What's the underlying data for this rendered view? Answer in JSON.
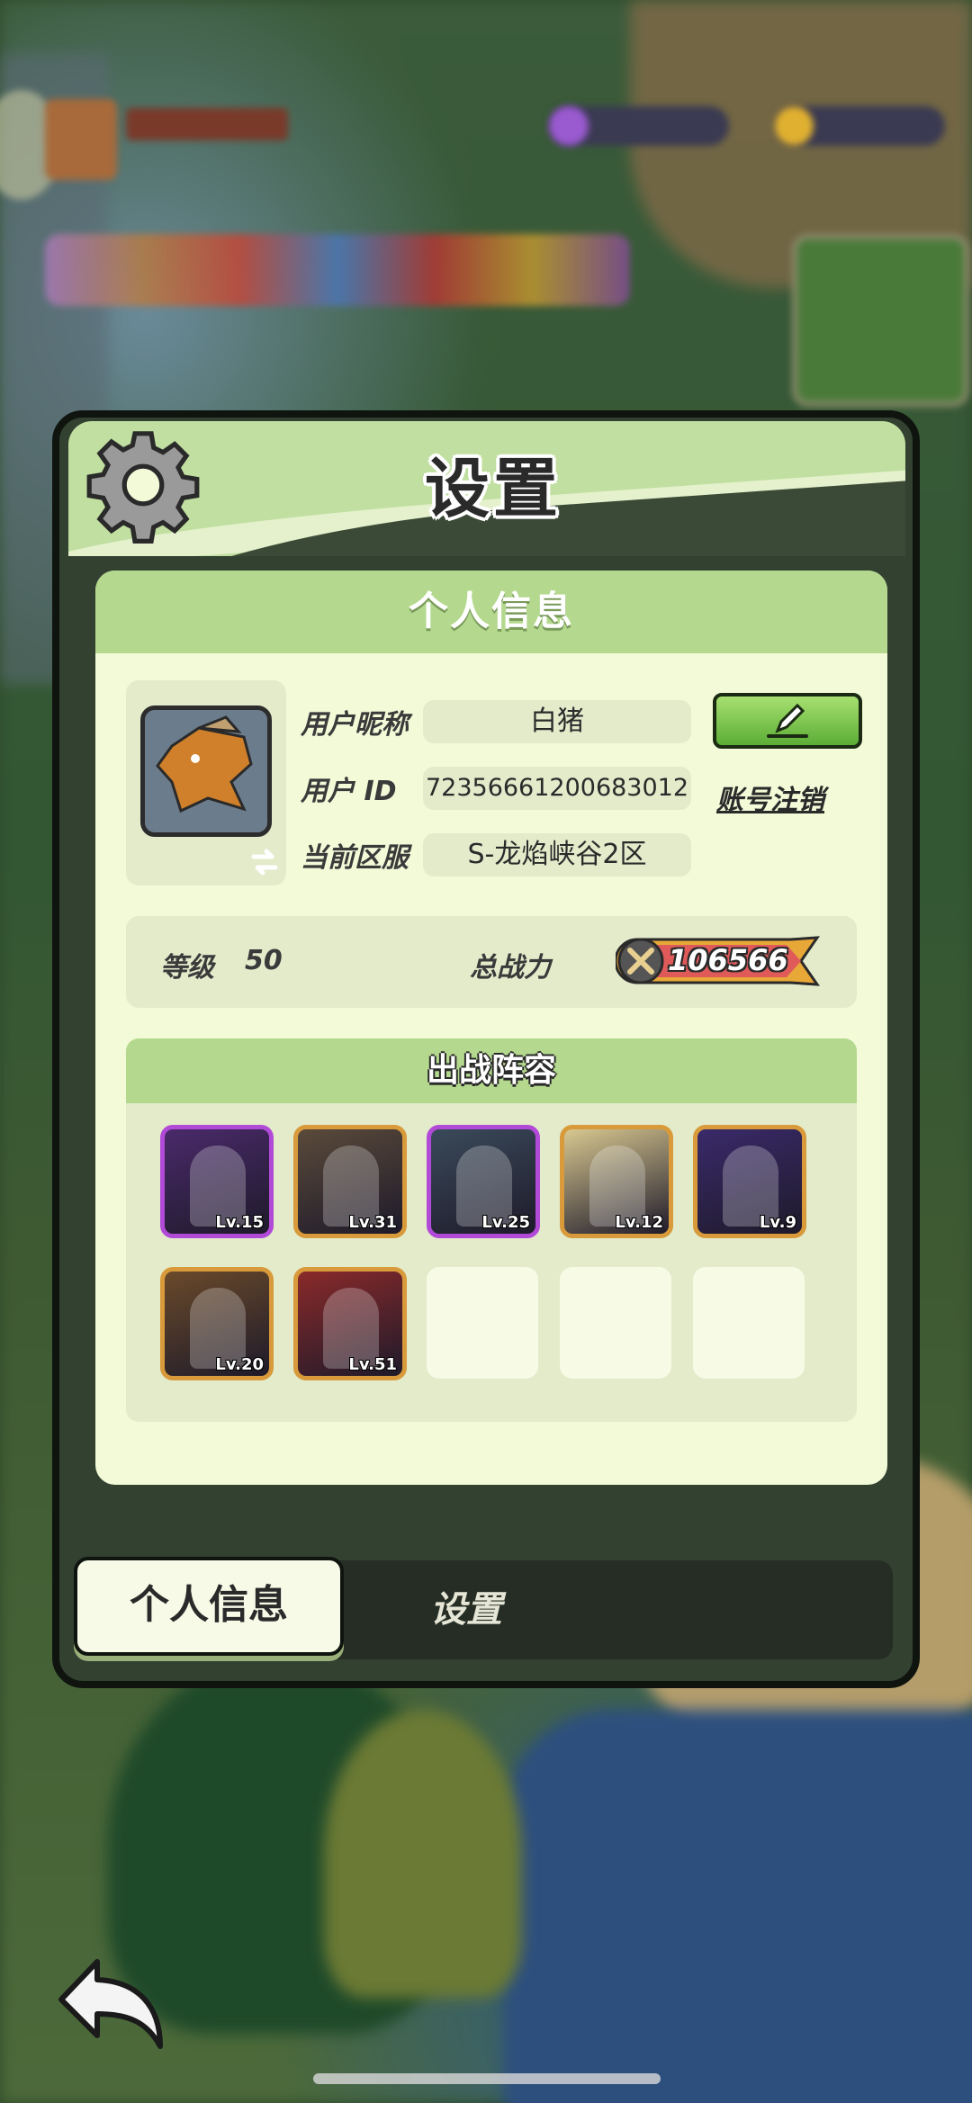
{
  "panel": {
    "title": "设置",
    "card_title": "个人信息",
    "profile": {
      "nickname_label": "用户昵称",
      "nickname": "白猪",
      "id_label": "用户  ID",
      "user_id": "72356661200683012",
      "server_label": "当前区服",
      "server": "S-龙焰峡谷2区",
      "cancel_account": "账号注销"
    },
    "stats": {
      "level_label": "等级",
      "level": "50",
      "power_label": "总战力",
      "power": "106566"
    },
    "lineup": {
      "title": "出战阵容",
      "heroes": [
        {
          "level": "Lv.15",
          "frame": "purple",
          "color": "#4a2a6a"
        },
        {
          "level": "Lv.31",
          "frame": "gold",
          "color": "#5a4a3a"
        },
        {
          "level": "Lv.25",
          "frame": "purple",
          "color": "#3a4a5a"
        },
        {
          "level": "Lv.12",
          "frame": "gold",
          "color": "#d8c890"
        },
        {
          "level": "Lv.9",
          "frame": "gold",
          "color": "#3a2a6a"
        },
        {
          "level": "Lv.20",
          "frame": "gold",
          "color": "#6a4a2a"
        },
        {
          "level": "Lv.51",
          "frame": "gold",
          "color": "#8a2a2a"
        }
      ],
      "empty_slots": 3
    }
  },
  "tabs": {
    "personal": "个人信息",
    "settings": "设置"
  },
  "colors": {
    "header_green": "#c0dfa0",
    "card_bg": "#f3fad8",
    "edit_green": "#5cad36",
    "panel_dark": "#334131"
  }
}
